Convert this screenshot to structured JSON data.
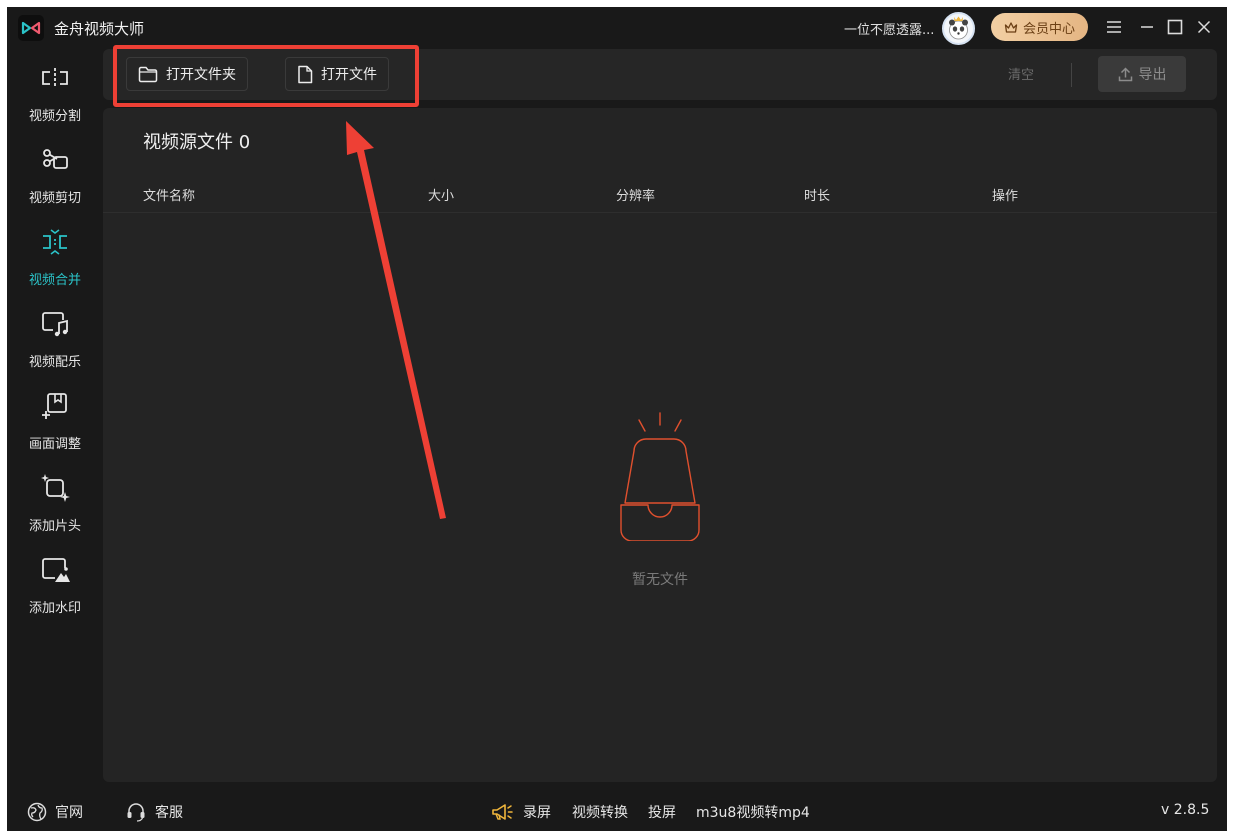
{
  "app": {
    "title": "金舟视频大师"
  },
  "header": {
    "username": "一位不愿透露...",
    "member_label": "会员中心"
  },
  "sidebar": {
    "items": [
      {
        "label": "视频分割",
        "icon": "video-split-icon",
        "active": false
      },
      {
        "label": "视频剪切",
        "icon": "scissors-icon",
        "active": false
      },
      {
        "label": "视频合并",
        "icon": "video-merge-icon",
        "active": true
      },
      {
        "label": "视频配乐",
        "icon": "music-note-icon",
        "active": false
      },
      {
        "label": "画面调整",
        "icon": "crop-adjust-icon",
        "active": false
      },
      {
        "label": "添加片头",
        "icon": "sparkle-frame-icon",
        "active": false
      },
      {
        "label": "添加水印",
        "icon": "watermark-image-icon",
        "active": false
      }
    ]
  },
  "toolbar": {
    "open_folder": "打开文件夹",
    "open_file": "打开文件",
    "clear": "清空",
    "export": "导出"
  },
  "main": {
    "title": "视频源文件 0",
    "columns": [
      "文件名称",
      "大小",
      "分辨率",
      "时长",
      "操作"
    ],
    "empty_text": "暂无文件"
  },
  "statusbar": {
    "website": "官网",
    "support": "客服",
    "record": "录屏",
    "convert": "视频转换",
    "cast": "投屏",
    "m3u8": "m3u8视频转mp4",
    "version": "v 2.8.5"
  },
  "colors": {
    "accent": "#2bc3c8",
    "annotation": "#ee4035",
    "empty_icon": "#e0502e",
    "member_gold": "#e9c08f"
  }
}
